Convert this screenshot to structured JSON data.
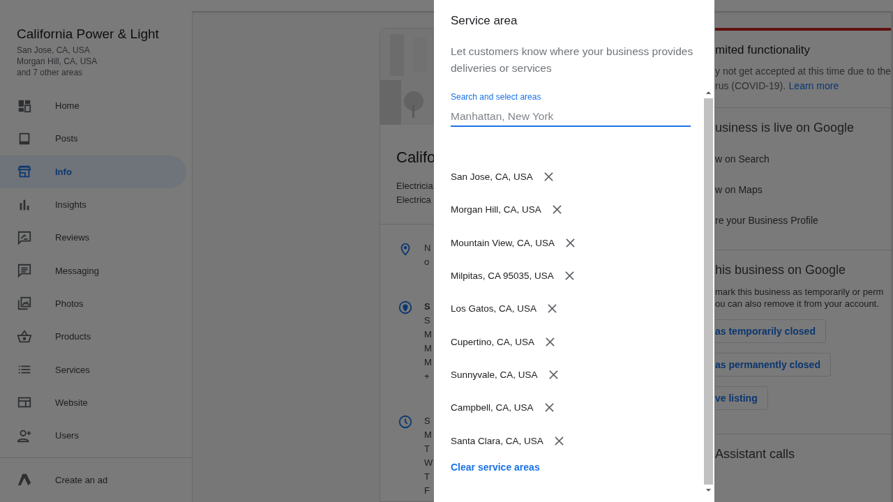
{
  "sidebar": {
    "business_name": "California Power & Light",
    "areas": [
      "San Jose, CA, USA",
      "Morgan Hill, CA, USA",
      "and 7 other areas"
    ],
    "items": [
      {
        "label": "Home",
        "selected": false
      },
      {
        "label": "Posts",
        "selected": false
      },
      {
        "label": "Info",
        "selected": true
      },
      {
        "label": "Insights",
        "selected": false
      },
      {
        "label": "Reviews",
        "selected": false
      },
      {
        "label": "Messaging",
        "selected": false
      },
      {
        "label": "Photos",
        "selected": false
      },
      {
        "label": "Products",
        "selected": false
      },
      {
        "label": "Services",
        "selected": false
      },
      {
        "label": "Website",
        "selected": false
      },
      {
        "label": "Users",
        "selected": false
      }
    ],
    "create_ad": "Create an ad"
  },
  "info_card": {
    "title": "Califo",
    "categories": [
      "Electricia",
      "Electrica"
    ],
    "sections": [
      {
        "lines": [
          "N",
          "o"
        ]
      },
      {
        "lines": [
          "S",
          "S",
          "M",
          "M",
          "M",
          "+"
        ]
      },
      {
        "lines": [
          "S",
          "M",
          "T",
          "W",
          "T",
          "F"
        ]
      }
    ]
  },
  "right_panel": {
    "notice_title": "mited functionality",
    "notice_lines": [
      "y not get accepted at this time due to the",
      "rus (COVID-19)."
    ],
    "notice_link": "Learn more",
    "live_title": "usiness is live on Google",
    "live_links": [
      "w on Search",
      "w on Maps",
      "re your Business Profile"
    ],
    "close_title": "his business on Google",
    "close_lines": [
      "mark this business as temporarily or perm",
      "ou can also remove it from your account."
    ],
    "close_buttons": [
      "as temporarily closed",
      "as permanently closed",
      "ve listing"
    ],
    "assistant_title": "Assistant calls"
  },
  "dialog": {
    "title": "Service area",
    "description": "Let customers know where your business provides deliveries or services",
    "search": {
      "label": "Search and select areas",
      "placeholder": "Manhattan, New York"
    },
    "areas": [
      "San Jose, CA, USA",
      "Morgan Hill, CA, USA",
      "Mountain View, CA, USA",
      "Milpitas, CA 95035, USA",
      "Los Gatos, CA, USA",
      "Cupertino, CA, USA",
      "Sunnyvale, CA, USA",
      "Campbell, CA, USA",
      "Santa Clara, CA, USA"
    ],
    "clear_button": "Clear service areas"
  }
}
